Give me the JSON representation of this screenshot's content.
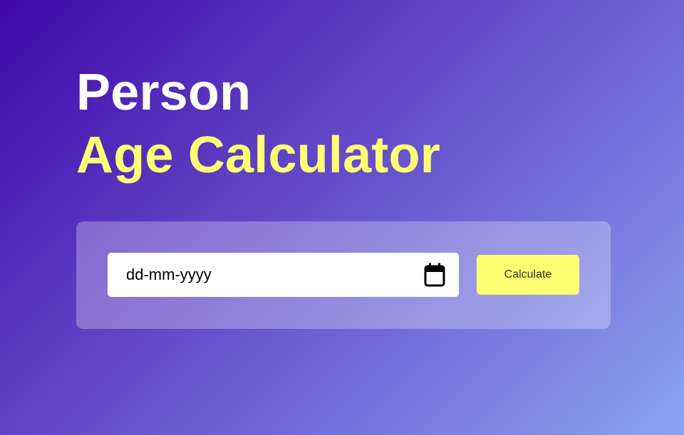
{
  "heading": {
    "line1": "Person",
    "line2": "Age Calculator"
  },
  "form": {
    "date_placeholder": "dd-mm-yyyy",
    "calendar_icon": "calendar-icon",
    "button_label": "Calculate"
  },
  "colors": {
    "accent": "#ffff73",
    "background_start": "#4007a8",
    "background_end": "#8aa4f0"
  }
}
